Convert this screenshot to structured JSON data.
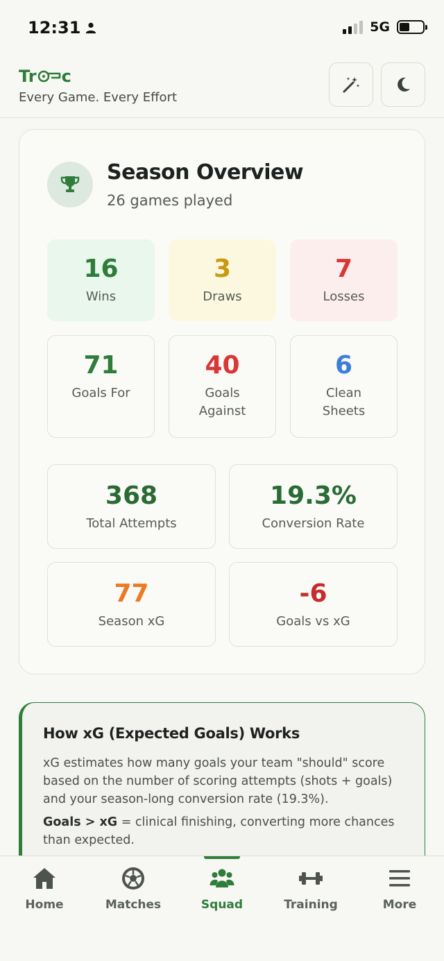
{
  "status_bar": {
    "time": "12:31",
    "network": "5G"
  },
  "header": {
    "brand_prefix": "Tr",
    "brand_suffix": "c",
    "tagline": "Every Game. Every Effort"
  },
  "season": {
    "title": "Season Overview",
    "subtitle": "26 games played",
    "results": [
      {
        "value": "16",
        "label": "Wins"
      },
      {
        "value": "3",
        "label": "Draws"
      },
      {
        "value": "7",
        "label": "Losses"
      }
    ],
    "goals": [
      {
        "value": "71",
        "label": "Goals For"
      },
      {
        "value": "40",
        "label": "Goals Against"
      },
      {
        "value": "6",
        "label": "Clean Sheets"
      }
    ],
    "attempts": {
      "value": "368",
      "label": "Total Attempts"
    },
    "conversion": {
      "value": "19.3%",
      "label": "Conversion Rate"
    },
    "xg": {
      "value": "77",
      "label": "Season xG"
    },
    "goals_vs_xg": {
      "value": "-6",
      "label": "Goals vs xG"
    }
  },
  "xg_info": {
    "title": "How xG (Expected Goals) Works",
    "paragraph1": "xG estimates how many goals your team \"should\" score based on the number of scoring attempts (shots + goals) and your season-long conversion rate (19.3%).",
    "paragraph2_bold": "Goals > xG",
    "paragraph2_rest": " = clinical finishing, converting more chances than expected."
  },
  "nav": {
    "items": [
      {
        "label": "Home",
        "icon": "home-icon"
      },
      {
        "label": "Matches",
        "icon": "soccer-ball-icon"
      },
      {
        "label": "Squad",
        "icon": "users-icon"
      },
      {
        "label": "Training",
        "icon": "dumbbell-icon"
      },
      {
        "label": "More",
        "icon": "menu-icon"
      }
    ],
    "active": "Squad"
  },
  "colors": {
    "brand_green": "#2e7d3a",
    "draw_gold": "#c89a10",
    "loss_red": "#d93636",
    "clean_blue": "#3b7fd6",
    "xg_orange": "#ec7a25"
  }
}
